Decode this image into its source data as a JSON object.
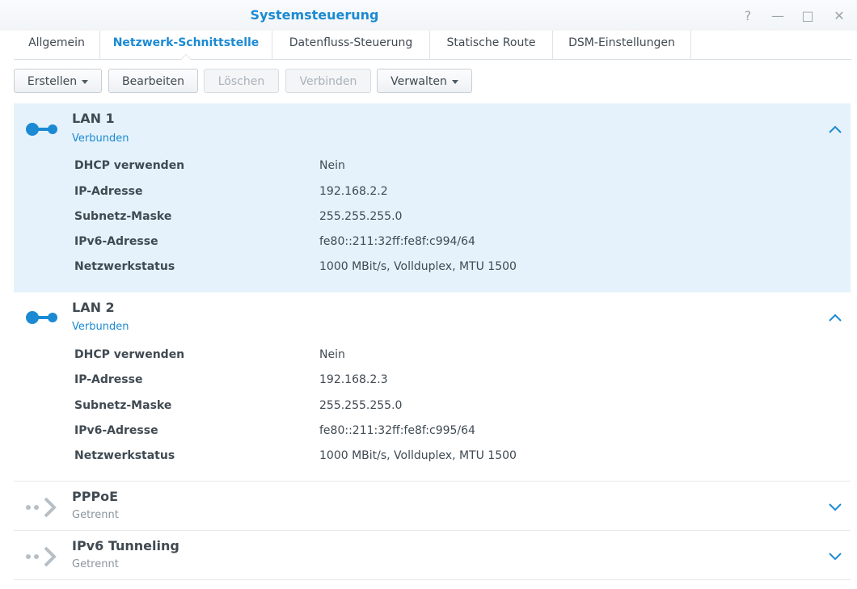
{
  "window": {
    "title": "Systemsteuerung",
    "controls": {
      "help": "?",
      "minimize": "—",
      "maximize": "□",
      "close": "✕"
    }
  },
  "tabs": [
    {
      "label": "Allgemein"
    },
    {
      "label": "Netzwerk-Schnittstelle",
      "active": true
    },
    {
      "label": "Datenfluss-Steuerung"
    },
    {
      "label": "Statische Route"
    },
    {
      "label": "DSM-Einstellungen"
    }
  ],
  "toolbar": {
    "create": "Erstellen",
    "edit": "Bearbeiten",
    "delete": "Löschen",
    "connect": "Verbinden",
    "manage": "Verwalten"
  },
  "interfaces": [
    {
      "name": "LAN 1",
      "status": "Verbunden",
      "expanded": true,
      "details": [
        {
          "key": "DHCP verwenden",
          "value": "Nein"
        },
        {
          "key": "IP-Adresse",
          "value": "192.168.2.2"
        },
        {
          "key": "Subnetz-Maske",
          "value": "255.255.255.0"
        },
        {
          "key": "IPv6-Adresse",
          "value": "fe80::211:32ff:fe8f:c994/64"
        },
        {
          "key": "Netzwerkstatus",
          "value": "1000 MBit/s, Vollduplex, MTU 1500"
        }
      ]
    },
    {
      "name": "LAN 2",
      "status": "Verbunden",
      "expanded": true,
      "details": [
        {
          "key": "DHCP verwenden",
          "value": "Nein"
        },
        {
          "key": "IP-Adresse",
          "value": "192.168.2.3"
        },
        {
          "key": "Subnetz-Maske",
          "value": "255.255.255.0"
        },
        {
          "key": "IPv6-Adresse",
          "value": "fe80::211:32ff:fe8f:c995/64"
        },
        {
          "key": "Netzwerkstatus",
          "value": "1000 MBit/s, Vollduplex, MTU 1500"
        }
      ]
    },
    {
      "name": "PPPoE",
      "status": "Getrennt",
      "expanded": false
    },
    {
      "name": "IPv6 Tunneling",
      "status": "Getrennt",
      "expanded": false
    }
  ],
  "colors": {
    "accent": "#1b8ad3",
    "selected_row": "#e5f2fb",
    "disconnected_icon": "#b7bfc6"
  },
  "icons": {
    "connected": "connected-plug-icon",
    "disconnected": "disconnected-arrow-icon",
    "expanded": "chevron-up-icon",
    "collapsed": "chevron-down-icon"
  }
}
